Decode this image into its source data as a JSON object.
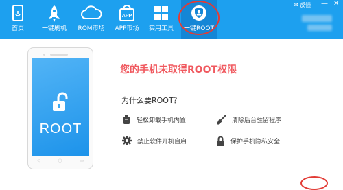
{
  "nav": [
    {
      "label": "首页",
      "icon": "home-phone-icon"
    },
    {
      "label": "一键刷机",
      "icon": "rocket-icon"
    },
    {
      "label": "ROM市场",
      "icon": "cloud-icon"
    },
    {
      "label": "APP市场",
      "icon": "app-bag-icon"
    },
    {
      "label": "实用工具",
      "icon": "windows-grid-icon"
    },
    {
      "label": "一键ROOT",
      "icon": "root-shield-icon"
    }
  ],
  "window_controls": {
    "feedback": "反馈"
  },
  "phone": {
    "label": "ROOT"
  },
  "main": {
    "headline": "您的手机未取得ROOT权限",
    "why_title": "为什么要ROOT？",
    "features": [
      {
        "label": "轻松卸载手机内置",
        "icon": "uninstall-icon"
      },
      {
        "label": "清除后台驻留程序",
        "icon": "broom-icon"
      },
      {
        "label": "禁止软件开机自启",
        "icon": "gear-icon"
      },
      {
        "label": "保护手机隐私安全",
        "icon": "lock-icon"
      }
    ]
  },
  "colors": {
    "topbar": "#1da0ef",
    "active_tab": "#1486d6",
    "headline": "#f0595f",
    "annotation_circle": "#e23b35"
  }
}
